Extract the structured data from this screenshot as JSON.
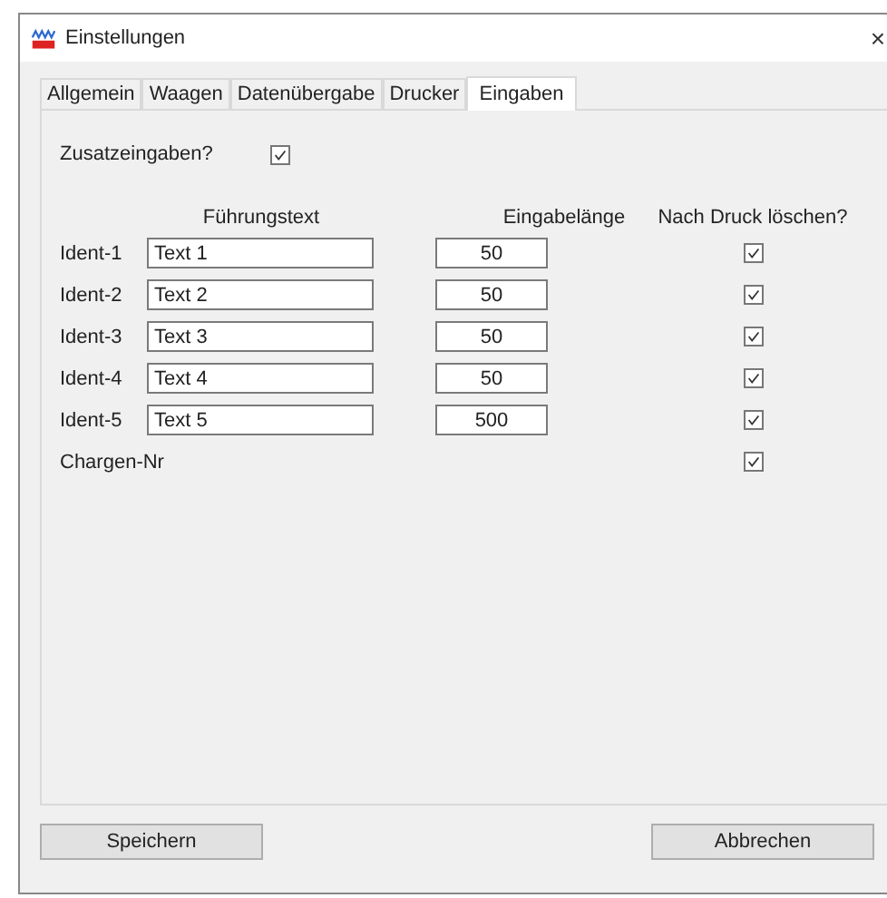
{
  "window": {
    "title": "Einstellungen",
    "close": "×"
  },
  "tabs": [
    {
      "label": "Allgemein",
      "selected": false
    },
    {
      "label": "Waagen",
      "selected": false
    },
    {
      "label": "Datenübergabe",
      "selected": false
    },
    {
      "label": "Drucker",
      "selected": false
    },
    {
      "label": "Eingaben",
      "selected": true
    }
  ],
  "extra_inputs": {
    "label": "Zusatzeingaben?",
    "checked": true
  },
  "columns": [
    "Führungstext",
    "Eingabelänge",
    "Nach Druck löschen?"
  ],
  "rows": [
    {
      "label": "Ident-1",
      "kind": "field",
      "text": "Text 1",
      "length": "50",
      "clear": true
    },
    {
      "label": "Ident-2",
      "kind": "field",
      "text": "Text 2",
      "length": "50",
      "clear": true
    },
    {
      "label": "Ident-3",
      "kind": "field",
      "text": "Text 3",
      "length": "50",
      "clear": true
    },
    {
      "label": "Ident-4",
      "kind": "field",
      "text": "Text 4",
      "length": "50",
      "clear": true
    },
    {
      "label": "Ident-5",
      "kind": "field",
      "text": "Text 5",
      "length": "500",
      "clear": true
    },
    {
      "label": "Chargen-Nr",
      "kind": "plain",
      "clear": true
    }
  ],
  "buttons": [
    "Speichern",
    "Abbrechen"
  ]
}
